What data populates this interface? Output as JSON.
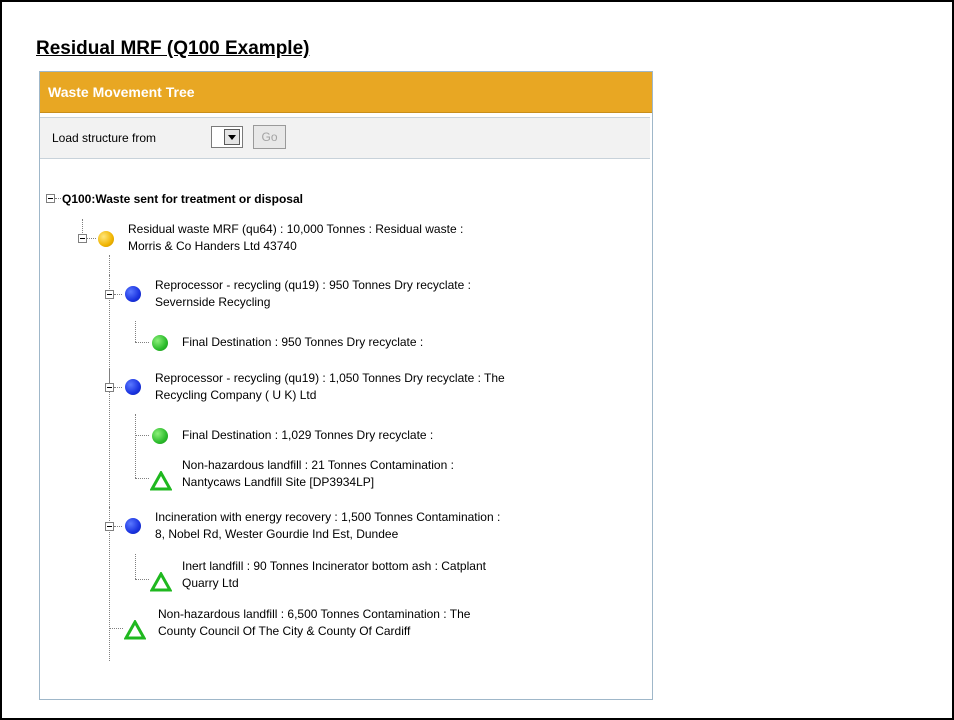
{
  "slide": {
    "title": "Residual MRF (Q100 Example)"
  },
  "panel": {
    "header": "Waste Movement Tree",
    "toolbar": {
      "label": "Load structure from",
      "dropdown_value": "",
      "go_label": "Go"
    }
  },
  "tree": {
    "root_label": "Q100:Waste sent for treatment or disposal",
    "nodes": [
      {
        "text": "Residual waste MRF (qu64) : 10,000 Tonnes : Residual waste :\nMorris & Co Handers Ltd 43740",
        "marker": "yellow-dot-icon"
      },
      {
        "text": "Reprocessor - recycling (qu19) : 950 Tonnes Dry recyclate :\nSevernside Recycling",
        "marker": "blue-dot-icon"
      },
      {
        "text": "Final Destination : 950 Tonnes Dry recyclate :",
        "marker": "green-dot-icon"
      },
      {
        "text": "Reprocessor - recycling (qu19) : 1,050 Tonnes Dry recyclate : The\nRecycling Company ( U K) Ltd",
        "marker": "blue-dot-icon"
      },
      {
        "text": "Final Destination : 1,029 Tonnes Dry recyclate :",
        "marker": "green-dot-icon"
      },
      {
        "text": "Non-hazardous landfill : 21 Tonnes Contamination :\nNantycaws Landfill Site [DP3934LP]",
        "marker": "green-triangle-icon"
      },
      {
        "text": "Incineration with energy recovery : 1,500 Tonnes Contamination :\n8, Nobel Rd, Wester Gourdie Ind Est, Dundee",
        "marker": "blue-dot-icon"
      },
      {
        "text": "Inert landfill : 90 Tonnes Incinerator bottom ash : Catplant\nQuarry Ltd",
        "marker": "green-triangle-icon"
      },
      {
        "text": "Non-hazardous landfill : 6,500 Tonnes Contamination : The\nCounty Council Of The City & County Of Cardiff",
        "marker": "green-triangle-icon"
      }
    ]
  },
  "colors": {
    "header_bg": "#e8a723",
    "panel_border": "#9fb7c9",
    "toolbar_bg": "#f2f2f2",
    "yellow_marker": "#f0b400",
    "blue_marker": "#1a33e0",
    "green_marker": "#2bbb2b"
  }
}
